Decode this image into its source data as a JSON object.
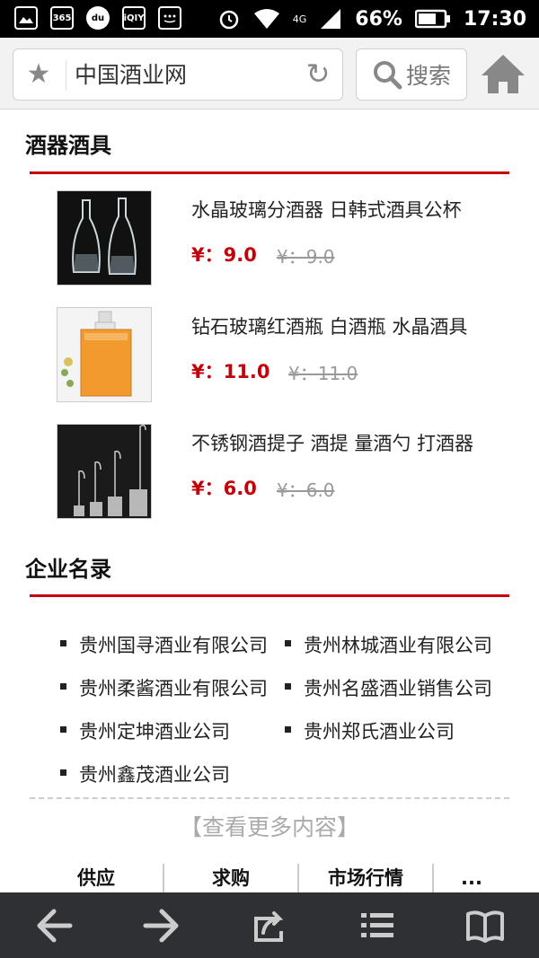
{
  "status": {
    "network": "4G",
    "battery": "66%",
    "time": "17:30"
  },
  "url": {
    "text": "中国酒业网",
    "search_label": "搜索"
  },
  "section1": {
    "title": "酒器酒具"
  },
  "products": [
    {
      "name": "水晶玻璃分酒器 日韩式酒具公杯",
      "price": "¥：9.0",
      "old_price": "¥：9.0"
    },
    {
      "name": "钻石玻璃红酒瓶 白酒瓶 水晶酒具",
      "price": "¥：11.0",
      "old_price": "¥：11.0"
    },
    {
      "name": "不锈钢酒提子 酒提 量酒勺 打酒器",
      "price": "¥：6.0",
      "old_price": "¥：6.0"
    }
  ],
  "section2": {
    "title": "企业名录"
  },
  "companies": [
    "贵州国寻酒业有限公司",
    "贵州林城酒业有限公司",
    "贵州柔酱酒业有限公司",
    "贵州名盛酒业销售公司",
    "贵州定坤酒业公司",
    "贵州郑氏酒业公司",
    "贵州鑫茂酒业公司"
  ],
  "more_label": "【查看更多内容】",
  "tabs": [
    "供应",
    "求购",
    "市场行情",
    "..."
  ],
  "colors": {
    "accent": "#c4000a",
    "bottom_bar": "#2f3033"
  }
}
